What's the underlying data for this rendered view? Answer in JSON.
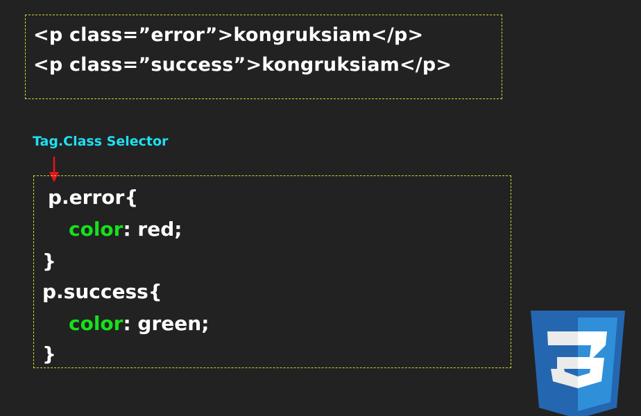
{
  "html_example": {
    "line1": "<p class=”error”>kongruksiam</p>",
    "line2": "<p class=”success”>kongruksiam</p>"
  },
  "selector_label": "Tag.Class Selector",
  "css_example": {
    "rule1_selector": "p.error{",
    "rule1_property": "color",
    "rule1_value": ": red;",
    "rule1_close": "}",
    "rule2_selector": "p.success{",
    "rule2_property": "color",
    "rule2_value": ": green;",
    "rule2_close": "}"
  },
  "colors": {
    "background": "#222222",
    "border": "#d6d63a",
    "label": "#1ee0f2",
    "arrow": "#e8141c",
    "property": "#17e01a",
    "css_logo": "#2566b0"
  },
  "icons": {
    "arrow": "arrow-down-icon",
    "logo": "css3-logo-icon"
  }
}
